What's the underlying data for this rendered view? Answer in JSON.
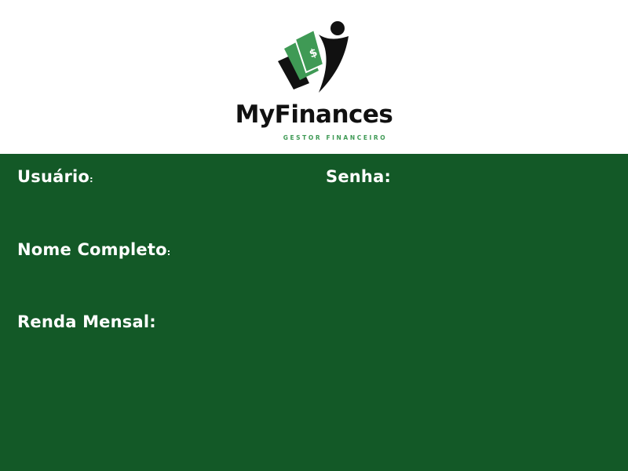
{
  "brand": {
    "name": "MyFinances",
    "tagline": "GESTOR FINANCEIRO"
  },
  "form": {
    "usuario_label": "Usuário",
    "usuario_colon": ":",
    "senha_label": "Senha:",
    "nome_label": "Nome Completo",
    "nome_colon": ":",
    "renda_label": "Renda Mensal:"
  },
  "colors": {
    "panel_background": "#135927",
    "brand_green": "#3f9a55",
    "brand_black": "#111111",
    "label_text": "#ffffff"
  },
  "icons": {
    "logo": "money-flying-person-logo"
  }
}
